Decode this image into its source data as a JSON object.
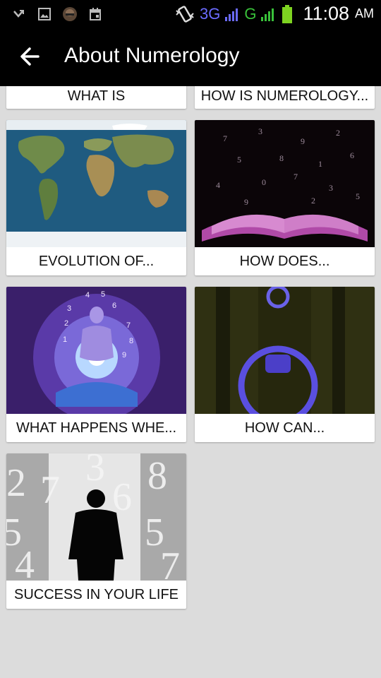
{
  "status_bar": {
    "network_3g": "3G",
    "network_g": "G",
    "time": "11:08",
    "ampm": "AM",
    "icons": [
      "missed-call-icon",
      "image-icon",
      "avatar-icon",
      "calendar-icon",
      "vibrate-icon",
      "signal-icon",
      "battery-icon"
    ]
  },
  "app_bar": {
    "title": "About Numerology"
  },
  "cards": [
    {
      "label": "WHAT IS"
    },
    {
      "label": "HOW IS NUMEROLOGY..."
    },
    {
      "label": "EVOLUTION OF..."
    },
    {
      "label": "HOW DOES..."
    },
    {
      "label": "WHAT HAPPENS WHE..."
    },
    {
      "label": "HOW CAN..."
    },
    {
      "label": "SUCCESS IN YOUR LIFE"
    }
  ],
  "colors": {
    "bar_bg": "#000000",
    "page_bg": "#dcdcdc",
    "network_3g": "#6b6bff",
    "network_g": "#39c13a",
    "battery": "#7ed321"
  }
}
